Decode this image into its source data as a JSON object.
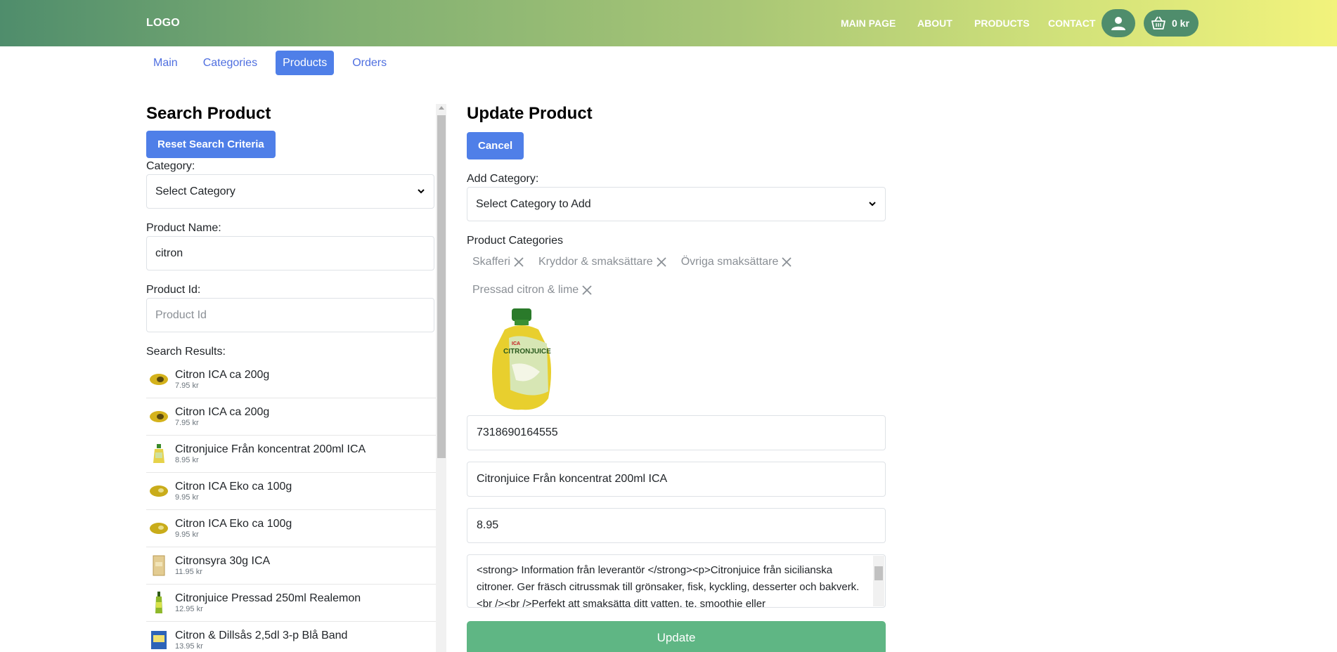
{
  "header": {
    "logo": "LOGO",
    "nav": [
      "MAIN PAGE",
      "ABOUT",
      "PRODUCTS",
      "CONTACT"
    ],
    "cart_amount": "0 kr"
  },
  "tabs": [
    "Main",
    "Categories",
    "Products",
    "Orders"
  ],
  "search": {
    "title": "Search Product",
    "reset_label": "Reset Search Criteria",
    "category_label": "Category:",
    "category_selected": "Select Category",
    "name_label": "Product Name:",
    "name_value": "citron",
    "id_label": "Product Id:",
    "id_placeholder": "Product Id",
    "results_label": "Search Results:",
    "results": [
      {
        "name": "Citron ICA ca 200g",
        "price": "7.95 kr",
        "icon": "lemon"
      },
      {
        "name": "Citron ICA ca 200g",
        "price": "7.95 kr",
        "icon": "lemon"
      },
      {
        "name": "Citronjuice Från koncentrat 200ml ICA",
        "price": "8.95 kr",
        "icon": "juice-bottle"
      },
      {
        "name": "Citron ICA Eko ca 100g",
        "price": "9.95 kr",
        "icon": "lemon"
      },
      {
        "name": "Citron ICA Eko ca 100g",
        "price": "9.95 kr",
        "icon": "lemon"
      },
      {
        "name": "Citronsyra 30g ICA",
        "price": "11.95 kr",
        "icon": "packet"
      },
      {
        "name": "Citronjuice Pressad 250ml Realemon",
        "price": "12.95 kr",
        "icon": "green-bottle"
      },
      {
        "name": "Citron & Dillsås 2,5dl 3-p Blå Band",
        "price": "13.95 kr",
        "icon": "sauce-pack"
      }
    ]
  },
  "update": {
    "title": "Update Product",
    "cancel_label": "Cancel",
    "add_category_label": "Add Category:",
    "add_category_selected": "Select Category to Add",
    "categories_label": "Product Categories",
    "categories": [
      "Skafferi",
      "Kryddor & smaksättare",
      "Övriga smaksättare",
      "Pressad citron & lime"
    ],
    "product_image_label": "CITRONJUICE",
    "product_image_brand": "ICA",
    "id_value": "7318690164555",
    "name_value": "Citronjuice Från koncentrat 200ml ICA",
    "price_value": "8.95",
    "description": "<strong> Information från leverantör </strong><p>Citronjuice från sicilianska citroner. Ger fräsch citrussmak till grönsaker, fisk, kyckling, desserter och bakverk. <br /><br />Perfekt att smaksätta ditt vatten, te, smoothie eller",
    "update_label": "Update"
  },
  "colors": {
    "primary": "#4f7fe8",
    "header_start": "#4f8d6c",
    "header_end": "#f2f37c",
    "update_green": "#5fb684"
  }
}
